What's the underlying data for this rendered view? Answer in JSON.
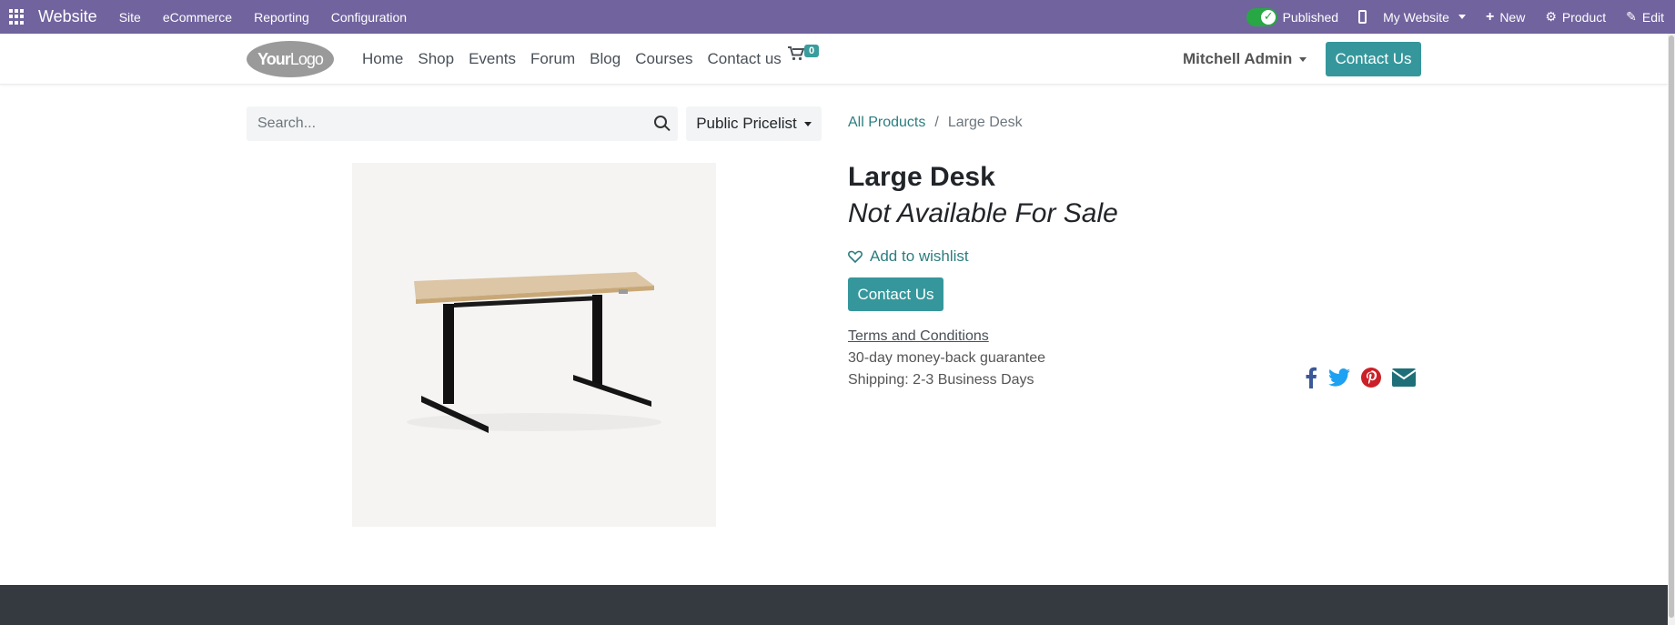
{
  "topbar": {
    "brand": "Website",
    "menus": [
      "Site",
      "eCommerce",
      "Reporting",
      "Configuration"
    ],
    "published_label": "Published",
    "website_label": "My Website",
    "new_label": "New",
    "product_label": "Product",
    "edit_label": "Edit"
  },
  "navbar": {
    "logo_bold": "Your",
    "logo_light": "Logo",
    "links": [
      "Home",
      "Shop",
      "Events",
      "Forum",
      "Blog",
      "Courses",
      "Contact us"
    ],
    "cart_count": "0",
    "user": "Mitchell Admin",
    "contact_button": "Contact Us"
  },
  "search": {
    "placeholder": "Search..."
  },
  "pricelist": {
    "label": "Public Pricelist"
  },
  "breadcrumb": {
    "parent": "All Products",
    "separator": "/",
    "current": "Large Desk"
  },
  "product": {
    "name": "Large Desk",
    "availability": "Not Available For Sale",
    "wishlist_label": "Add to wishlist",
    "contact_button": "Contact Us",
    "terms": "Terms and Conditions",
    "guarantee": "30-day money-back guarantee",
    "shipping": "Shipping: 2-3 Business Days"
  },
  "social": [
    "facebook-icon",
    "twitter-icon",
    "pinterest-icon",
    "email-icon"
  ],
  "colors": {
    "topbar": "#71639e",
    "accent": "#35979c",
    "link": "#2c7d7f",
    "footer": "#343a40"
  }
}
